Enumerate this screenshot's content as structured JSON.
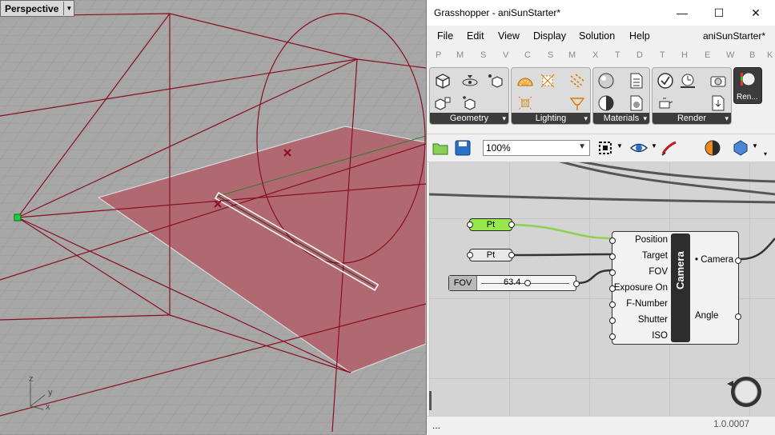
{
  "viewport": {
    "label": "Perspective",
    "axes": {
      "x": "x",
      "y": "y",
      "z": "z"
    }
  },
  "window": {
    "title": "Grasshopper - aniSunStarter*",
    "controls": {
      "minimize": "—",
      "maximize": "☐",
      "close": "✕"
    }
  },
  "menu": {
    "items": [
      "File",
      "Edit",
      "View",
      "Display",
      "Solution",
      "Help"
    ],
    "filename": "aniSunStarter*"
  },
  "tabs": [
    "P",
    "M",
    "S",
    "V",
    "C",
    "S",
    "M",
    "X",
    "T",
    "D",
    "T",
    "H",
    "E",
    "W",
    "B",
    "K"
  ],
  "ribbon": {
    "groups": [
      "Geometry",
      "Lighting",
      "Materials",
      "Render"
    ],
    "more": "▾",
    "render_tab": "Ren..."
  },
  "toolbar": {
    "zoom": "100%"
  },
  "canvas": {
    "pt1": "Pt",
    "pt2": "Pt",
    "slider": {
      "label": "FOV",
      "value": "63.4"
    },
    "camera": {
      "name": "Camera",
      "inputs": [
        "Position",
        "Target",
        "FOV",
        "Exposure On",
        "F-Number",
        "Shutter",
        "ISO"
      ],
      "outputs": [
        "• Camera",
        "Angle"
      ]
    }
  },
  "status": {
    "left": "...",
    "version": "1.0.0007"
  },
  "colors": {
    "wire_selected": "#8fd14f",
    "pt_active": "#96e84c",
    "frustum": "#8b0d1e",
    "plane_fill": "#b3545f"
  }
}
